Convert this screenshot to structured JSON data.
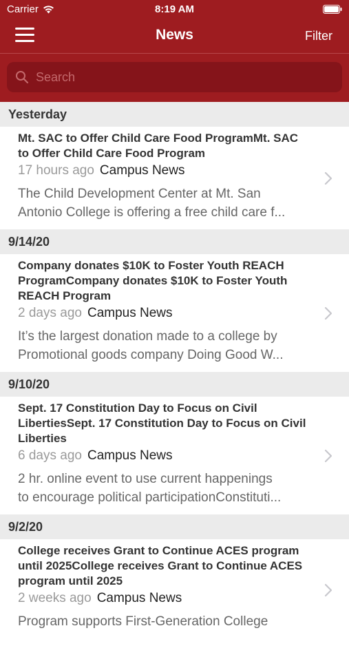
{
  "status_bar": {
    "carrier": "Carrier",
    "time": "8:19 AM"
  },
  "navbar": {
    "title": "News",
    "filter_label": "Filter"
  },
  "search": {
    "placeholder": "Search"
  },
  "sections": [
    {
      "header": "Yesterday",
      "items": [
        {
          "headline": "Mt. SAC to Offer Child Care Food ProgramMt. SAC to Offer Child Care Food Program",
          "time_ago": "17 hours ago",
          "source": "Campus News",
          "summary_line1": "The Child Development Center at Mt. San",
          "summary_line2": "Antonio College is offering a free child care f..."
        }
      ]
    },
    {
      "header": "9/14/20",
      "items": [
        {
          "headline": "Company donates $10K to Foster Youth REACH ProgramCompany donates $10K to Foster Youth REACH Program",
          "time_ago": "2 days ago",
          "source": "Campus News",
          "summary_line1": "It’s the largest donation made to a college by",
          "summary_line2": "Promotional goods company Doing Good W..."
        }
      ]
    },
    {
      "header": "9/10/20",
      "items": [
        {
          "headline": "Sept. 17 Constitution Day to Focus on Civil LibertiesSept. 17 Constitution Day to Focus on Civil Liberties",
          "time_ago": "6 days ago",
          "source": "Campus News",
          "summary_line1": "2 hr. online event to use current happenings",
          "summary_line2": "to encourage political participationConstituti..."
        }
      ]
    },
    {
      "header": "9/2/20",
      "items": [
        {
          "headline": "College receives Grant to Continue ACES program until 2025College receives Grant to Continue ACES program until 2025",
          "time_ago": "2 weeks ago",
          "source": "Campus News",
          "summary_line1": "Program supports First-Generation College",
          "summary_line2": ""
        }
      ]
    }
  ]
}
